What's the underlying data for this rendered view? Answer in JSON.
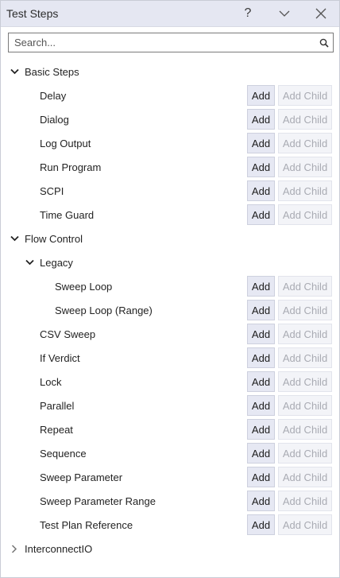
{
  "window": {
    "title": "Test Steps",
    "help_label": "?"
  },
  "search": {
    "placeholder": "Search..."
  },
  "buttons": {
    "add": "Add",
    "add_child": "Add Child"
  },
  "tree": {
    "basic_steps": {
      "label": "Basic Steps",
      "items": [
        "Delay",
        "Dialog",
        "Log Output",
        "Run Program",
        "SCPI",
        "Time Guard"
      ]
    },
    "flow_control": {
      "label": "Flow Control",
      "legacy": {
        "label": "Legacy",
        "items": [
          "Sweep Loop",
          "Sweep Loop (Range)"
        ]
      },
      "items": [
        "CSV Sweep",
        "If Verdict",
        "Lock",
        "Parallel",
        "Repeat",
        "Sequence",
        "Sweep Parameter",
        "Sweep Parameter Range",
        "Test Plan Reference"
      ]
    },
    "interconnect": {
      "label": "InterconnectIO"
    }
  },
  "colors": {
    "titlebar_bg": "#e5e7f2",
    "add_button_bg": "#e6e8f3",
    "disabled_text": "#a9abb3"
  }
}
